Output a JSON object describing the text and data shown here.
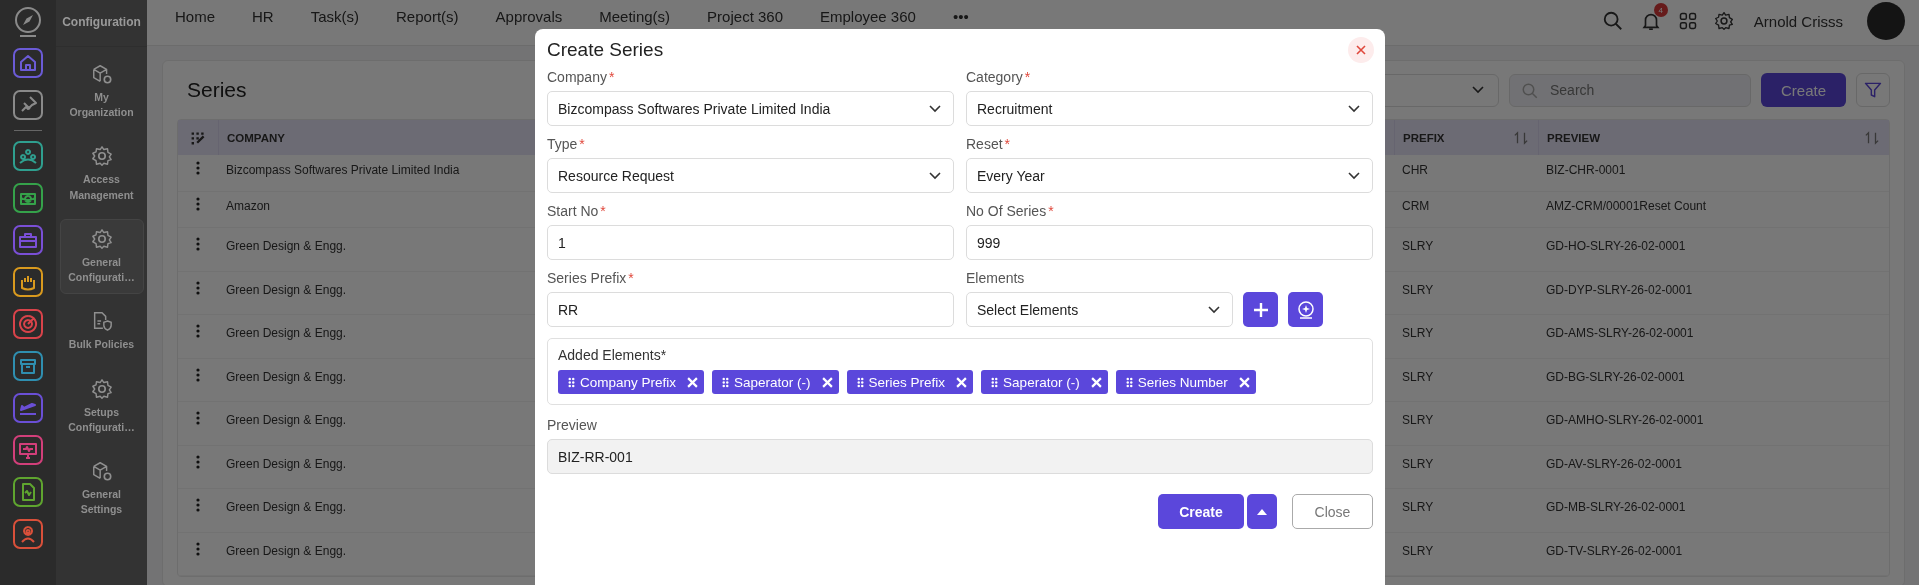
{
  "app": {
    "section_title": "Configuration"
  },
  "rail": {
    "items": [
      {
        "color": "#6b5bd6"
      },
      {
        "color": "#8a8a8a"
      },
      {
        "color": "#2f9f8f"
      },
      {
        "color": "#35a24a"
      },
      {
        "color": "#7a4fd6"
      },
      {
        "color": "#d99a1e"
      },
      {
        "color": "#d9434a"
      },
      {
        "color": "#2f8fb0"
      },
      {
        "color": "#6a4fd6"
      },
      {
        "color": "#d23f7a"
      },
      {
        "color": "#5fa52f"
      },
      {
        "color": "#d9503a"
      }
    ]
  },
  "sidebar": {
    "items": [
      {
        "label": "My Organization",
        "kind": "cube",
        "selected": false
      },
      {
        "label": "Access Management",
        "kind": "gear",
        "selected": false
      },
      {
        "label": "General Configurati…",
        "kind": "gear",
        "selected": true
      },
      {
        "label": "Bulk Policies",
        "kind": "document",
        "selected": false
      },
      {
        "label": "Setups Configurati…",
        "kind": "gear",
        "selected": false
      },
      {
        "label": "General Settings",
        "kind": "cube",
        "selected": false
      }
    ]
  },
  "top_nav": {
    "items": [
      "Home",
      "HR",
      "Task(s)",
      "Report(s)",
      "Approvals",
      "Meeting(s)",
      "Project 360",
      "Employee 360",
      "•••"
    ],
    "notifications": "4",
    "user_name": "Arnold Crisss"
  },
  "page": {
    "title": "Series",
    "search": {
      "placeholder": "Search"
    },
    "create_button": "Create"
  },
  "table": {
    "columns": [
      {
        "label": "COMPANY"
      },
      {
        "label": "PREFIX",
        "sortable": true
      },
      {
        "label": "PREVIEW",
        "sortable": true
      }
    ],
    "rows": [
      [
        "Bizcompass Softwares Private Limited India",
        "CHR",
        "BIZ-CHR-0001"
      ],
      [
        "Amazon",
        "CRM",
        "AMZ-CRM/00001Reset Count"
      ],
      [
        "Green Design & Engg.",
        "SLRY",
        "GD-HO-SLRY-26-02-0001"
      ],
      [
        "Green Design & Engg.",
        "SLRY",
        "GD-DYP-SLRY-26-02-0001"
      ],
      [
        "Green Design & Engg.",
        "SLRY",
        "GD-AMS-SLRY-26-02-0001"
      ],
      [
        "Green Design & Engg.",
        "SLRY",
        "GD-BG-SLRY-26-02-0001"
      ],
      [
        "Green Design & Engg.",
        "SLRY",
        "GD-AMHO-SLRY-26-02-0001"
      ],
      [
        "Green Design & Engg.",
        "SLRY",
        "GD-AV-SLRY-26-02-0001"
      ],
      [
        "Green Design & Engg.",
        "SLRY",
        "GD-MB-SLRY-26-02-0001"
      ],
      [
        "Green Design & Engg.",
        "SLRY",
        "GD-TV-SLRY-26-02-0001"
      ]
    ]
  },
  "modal": {
    "title": "Create Series",
    "fields": [
      {
        "label": "Company",
        "required_mark": "*",
        "kind": "select",
        "value": "Bizcompass Softwares Private Limited India"
      },
      {
        "label": "Category",
        "required_mark": "*",
        "kind": "select",
        "value": "Recruitment"
      },
      {
        "label": "Type",
        "required_mark": "*",
        "kind": "select",
        "value": "Resource Request"
      },
      {
        "label": "Reset",
        "required_mark": "*",
        "kind": "select",
        "value": "Every Year"
      },
      {
        "label": "Start No",
        "required_mark": "*",
        "kind": "input",
        "value": "1"
      },
      {
        "label": "No Of Series",
        "required_mark": "*",
        "kind": "input",
        "value": "999"
      },
      {
        "label": "Series Prefix",
        "required_mark": "*",
        "kind": "input",
        "value": "RR"
      },
      {
        "label": "Elements",
        "kind": "select_actions",
        "placeholder": "Select Elements"
      }
    ],
    "added_elements": {
      "label": "Added Elements*",
      "chips": [
        "Company Prefix",
        "Saperator (-)",
        "Series Prefix",
        "Saperator (-)",
        "Series Number"
      ]
    },
    "preview": {
      "label": "Preview",
      "value": "BIZ-RR-001"
    },
    "buttons": [
      {
        "kind": "primary",
        "label": "Create"
      },
      {
        "kind": "caret"
      },
      {
        "kind": "secondary",
        "label": "Close"
      }
    ]
  }
}
